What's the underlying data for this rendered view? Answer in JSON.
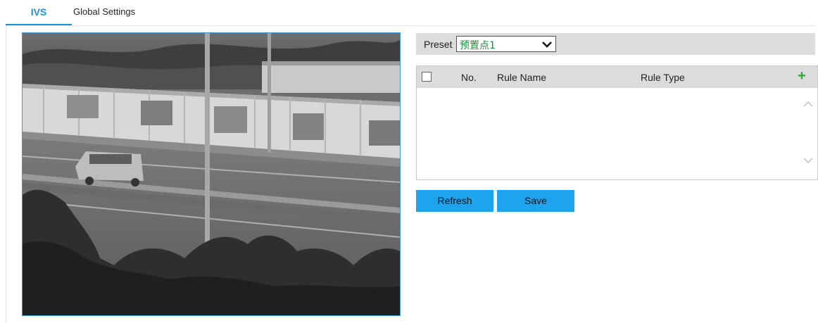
{
  "tabs": [
    {
      "label": "IVS",
      "active": true
    },
    {
      "label": "Global Settings",
      "active": false
    }
  ],
  "colors": {
    "accent": "#1ea4ee",
    "tab_active": "#1e90d8",
    "preset_value": "#1a8f3a",
    "add_icon": "#2eaa2e"
  },
  "preset": {
    "label": "Preset",
    "selected": "预置点1"
  },
  "rules_table": {
    "columns": [
      "No.",
      "Rule Name",
      "Rule Type"
    ],
    "rows": [],
    "add_icon": "plus-icon"
  },
  "buttons": {
    "refresh": "Refresh",
    "save": "Save"
  }
}
